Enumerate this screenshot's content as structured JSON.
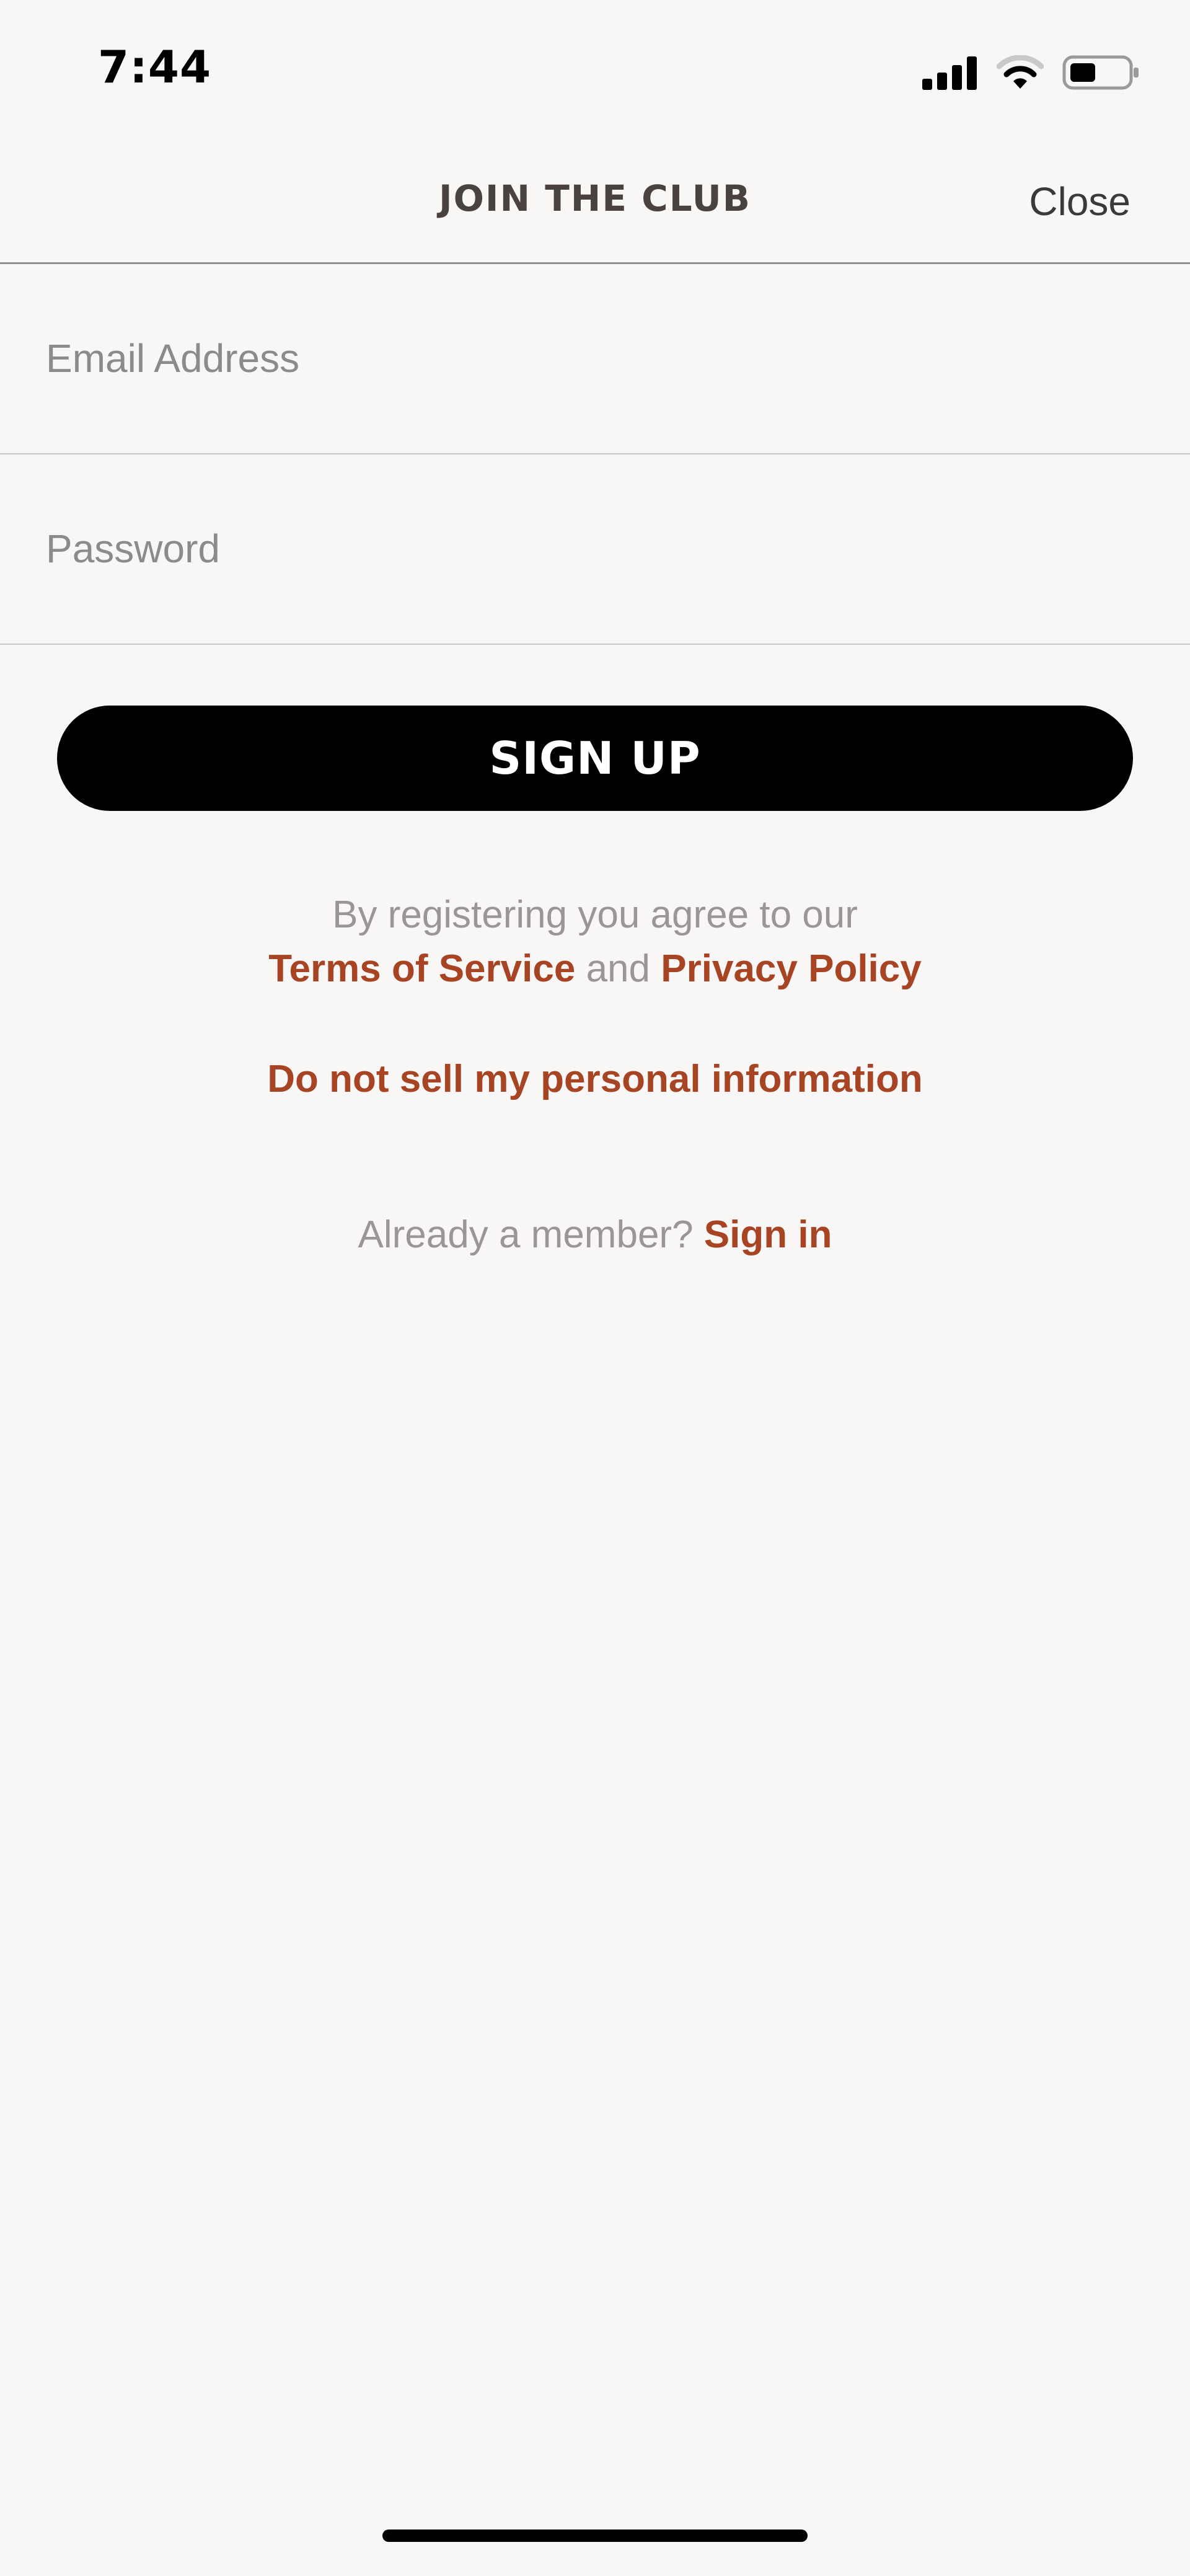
{
  "status_bar": {
    "time": "7:44",
    "icons": [
      "cellular-signal-icon",
      "wifi-icon",
      "battery-icon"
    ]
  },
  "header": {
    "title": "JOIN THE CLUB",
    "close_label": "Close"
  },
  "form": {
    "email": {
      "placeholder": "Email Address",
      "value": ""
    },
    "password": {
      "placeholder": "Password",
      "value": ""
    },
    "submit_label": "SIGN UP"
  },
  "legal": {
    "agree_text": "By registering you agree to our",
    "terms_label": "Terms of Service",
    "and_text": "and",
    "privacy_label": "Privacy Policy",
    "do_not_sell_label": "Do not sell my personal information"
  },
  "signin": {
    "prompt": "Already a member?",
    "link_label": "Sign in"
  },
  "colors": {
    "background": "#f8f7f5",
    "link": "#a64424",
    "button": "#000000",
    "muted_text": "#9a9696"
  }
}
